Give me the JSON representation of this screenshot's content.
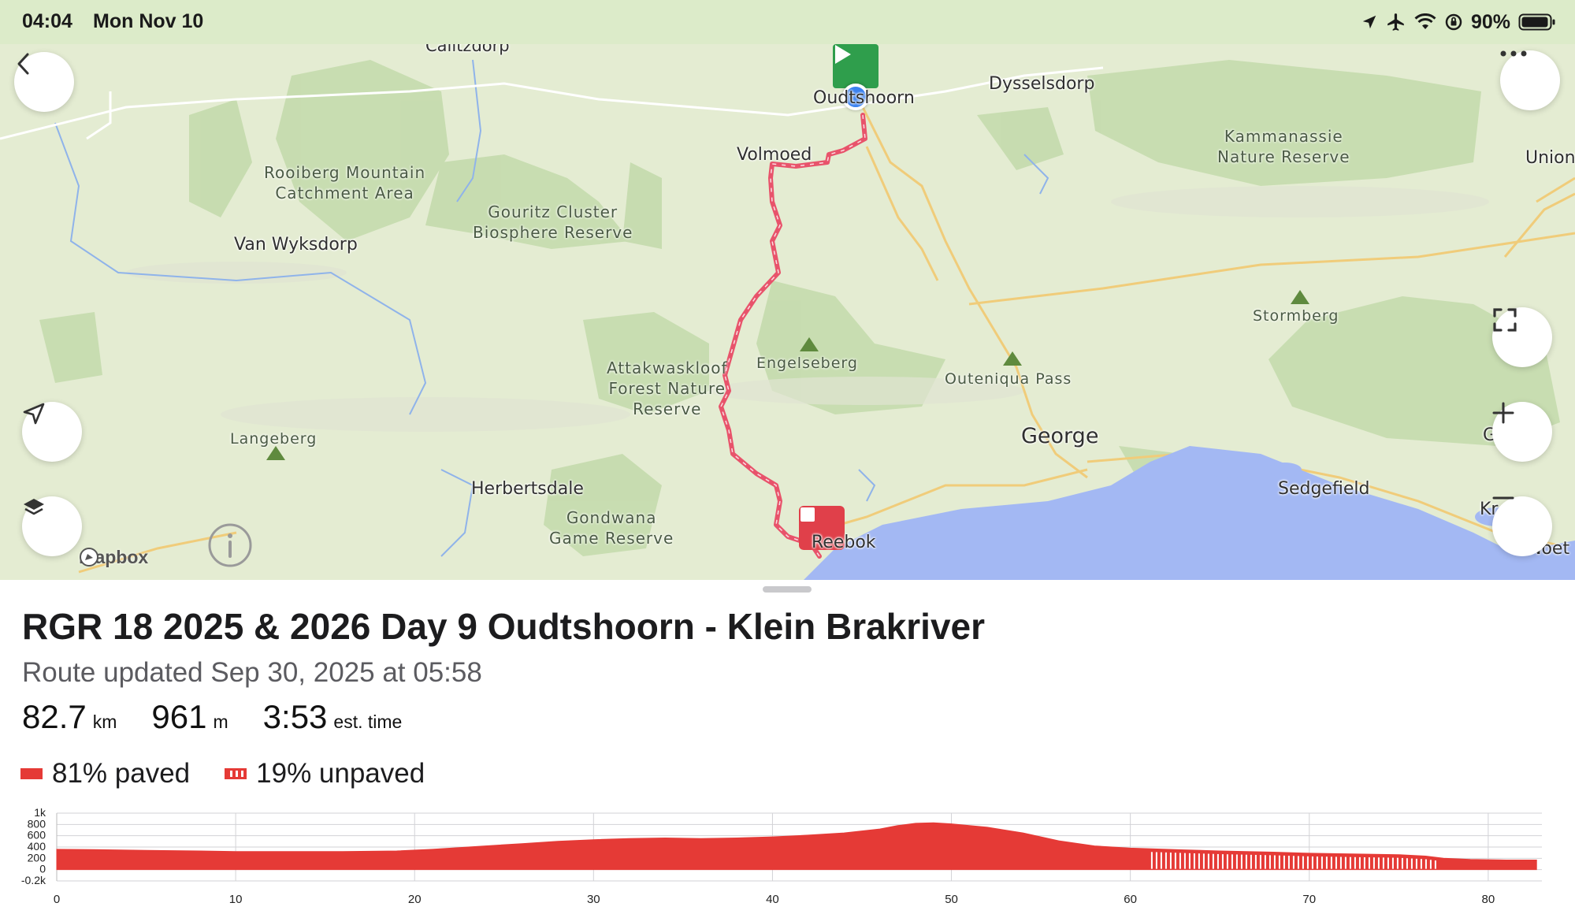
{
  "status_bar": {
    "time": "04:04",
    "date": "Mon Nov 10",
    "battery": "90%",
    "icons": [
      "location-arrow-icon",
      "airplane-icon",
      "wifi-icon",
      "rotation-lock-icon",
      "battery-icon"
    ]
  },
  "map": {
    "attribution": "mapbox",
    "places": {
      "calitzdorp": "Calitzdorp",
      "oudtshoorn": "Oudtshoorn",
      "dysselsdorp": "Dysselsdorp",
      "volmoed": "Volmoed",
      "van_wyksdorp": "Van Wyksdorp",
      "union": "Union",
      "george": "George",
      "sedgefield": "Sedgefield",
      "herbertsdale": "Herbertsdale",
      "reebok": "Reebok",
      "kr": "Kr",
      "noe": "Noet",
      "g": "G"
    },
    "parks": {
      "rooiberg": "Rooiberg Mountain\nCatchment Area",
      "gouritz": "Gouritz Cluster\nBiosphere Reserve",
      "kammanassie": "Kammanassie\nNature Reserve",
      "attakwaskloof": "Attakwaskloof\nForest Nature\nReserve",
      "gondwana": "Gondwana\nGame Reserve"
    },
    "peaks": {
      "stormberg": "Stormberg",
      "engelseberg": "Engelseberg",
      "outeniqua": "Outeniqua Pass",
      "langeberg": "Langeberg"
    },
    "colors": {
      "route": "#e8536b",
      "water": "#a3b8f3",
      "vegetation": "#c5dbab",
      "start": "#2f9e4c",
      "end": "#e0404a",
      "location": "#3b82f0"
    }
  },
  "route": {
    "title": "RGR 18 2025 & 2026 Day 9 Oudtshoorn - Klein Brakriver",
    "updated": "Route updated Sep 30, 2025 at 05:58",
    "distance": "82.7",
    "distance_unit": "km",
    "elevation": "961",
    "elevation_unit": "m",
    "time": "3:53",
    "time_unit": "est. time",
    "paved": "81% paved",
    "unpaved": "19% unpaved",
    "colors": {
      "paved": "#e53a36",
      "unpaved_stripe": "#ffffff"
    }
  },
  "chart_data": {
    "type": "area",
    "x_ticks": [
      "0",
      "10",
      "20",
      "30",
      "40",
      "50",
      "60",
      "70",
      "80"
    ],
    "y_ticks": [
      "1k",
      "800",
      "600",
      "400",
      "200",
      "0",
      "-0.2k"
    ],
    "xlim": [
      0,
      83
    ],
    "ylim": [
      -200,
      1000
    ],
    "x": [
      0,
      2,
      5,
      8,
      10,
      13,
      16,
      19,
      21,
      23,
      26,
      28,
      30,
      32,
      34,
      36,
      38,
      40,
      42,
      44,
      46,
      47,
      48,
      49,
      50,
      51,
      52,
      54,
      56,
      58,
      60,
      61,
      63,
      65,
      68,
      70,
      72,
      75,
      76.5,
      77.5,
      79,
      81,
      82.7
    ],
    "y": [
      360,
      355,
      340,
      330,
      320,
      320,
      320,
      330,
      360,
      400,
      460,
      500,
      530,
      550,
      560,
      550,
      560,
      580,
      610,
      650,
      720,
      780,
      820,
      830,
      810,
      780,
      750,
      650,
      510,
      420,
      380,
      370,
      350,
      330,
      310,
      290,
      280,
      265,
      240,
      200,
      180,
      170,
      170
    ],
    "unpaved_range": [
      61.2,
      77.2
    ],
    "color": "#e53a36"
  }
}
